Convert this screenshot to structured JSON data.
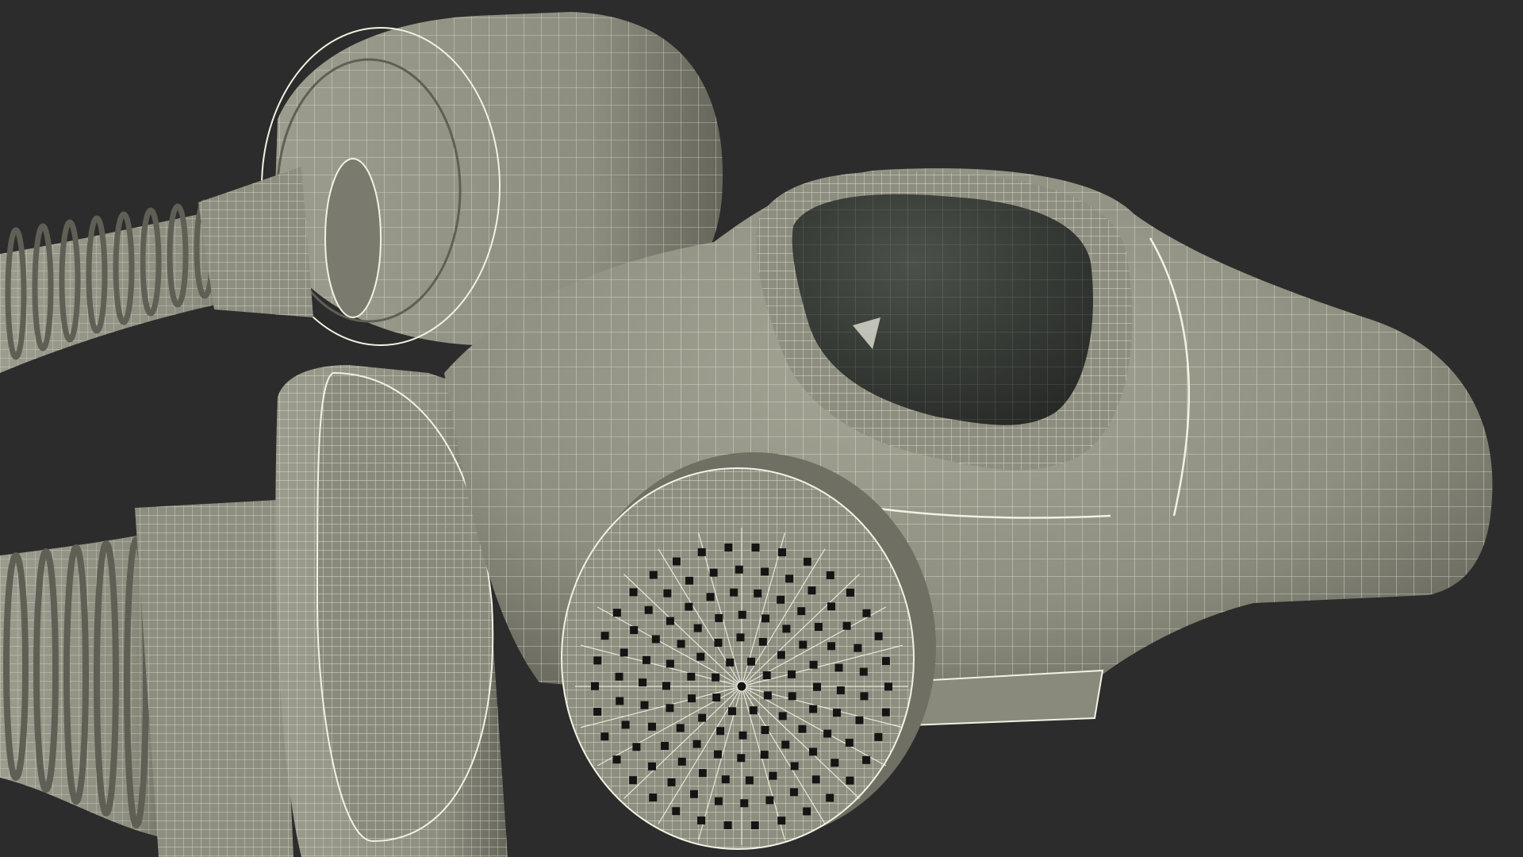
{
  "scene": {
    "subject": "gas-mask-wireframe",
    "colors": {
      "background": "#2c2c2c",
      "surface": "#8e8e80",
      "surface_light": "#a6a697",
      "surface_dark": "#5f5f55",
      "wire": "#f2f2e4",
      "lens": "#3b3f3a",
      "hole": "#141414"
    }
  }
}
